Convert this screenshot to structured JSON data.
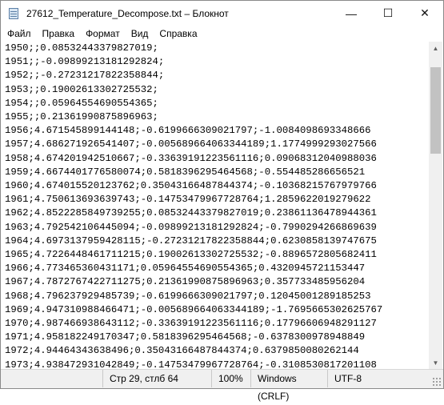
{
  "window": {
    "title": "27612_Temperature_Decompose.txt – Блокнот",
    "minimize_glyph": "—",
    "maximize_glyph": "☐",
    "close_glyph": "✕"
  },
  "menu": {
    "file": "Файл",
    "edit": "Правка",
    "format": "Формат",
    "view": "Вид",
    "help": "Справка"
  },
  "editor": {
    "lines": [
      "1950;;0.08532443379827019;",
      "1951;;-0.09899213181292824;",
      "1952;;-0.27231217822358844;",
      "1953;;0.19002613302725532;",
      "1954;;0.05964554690554365;",
      "1955;;0.21361990875896963;",
      "1956;4.671545899144148;-0.6199666309021797;-1.0084098693348666",
      "1957;4.686271926541407;-0.005689664063344189;1.1774999293027566",
      "1958;4.674201942510667;-0.33639191223561116;0.09068312040988036",
      "1959;4.6674401776580074;0.5818396295464568;-0.554485286656521",
      "1960;4.674015520123762;0.35043166487844374;-0.10368215767979766",
      "1961;4.750613693639743;-0.14753479967728764;1.2859622019279622",
      "1962;4.8522285849739255;0.08532443379827019;0.23861136478944361",
      "1963;4.792542106445094;-0.09899213181292824;-0.7990294266869639",
      "1964;4.6973137959428115;-0.27231217822358844;0.6230858139747675",
      "1965;4.7226448461711215;0.19002613302725532;-0.8896572805682411",
      "1966;4.773465360431171;0.05964554690554365;0.4320945721153447",
      "1967;4.7872767422711275;0.21361990875896963;0.357733485956204",
      "1968;4.796237929485739;-0.6199666309021797;0.12045001289185253",
      "1969;4.947310988466471;-0.005689664063344189;-1.7695665302625767",
      "1970;4.987466938643112;-0.33639191223561116;0.17796606948291127",
      "1971;4.958182249170347;0.5818396295464568;-0.6378300978948849",
      "1972;4.94464343638496;0.35043166487844374;0.6379850080262144",
      "1973;4.938472931042849;-0.14753479967728764;-0.3108530817201108"
    ]
  },
  "status": {
    "position": "Стр 29, стлб 64",
    "zoom": "100%",
    "line_endings": "Windows (CRLF)",
    "encoding": "UTF-8"
  }
}
